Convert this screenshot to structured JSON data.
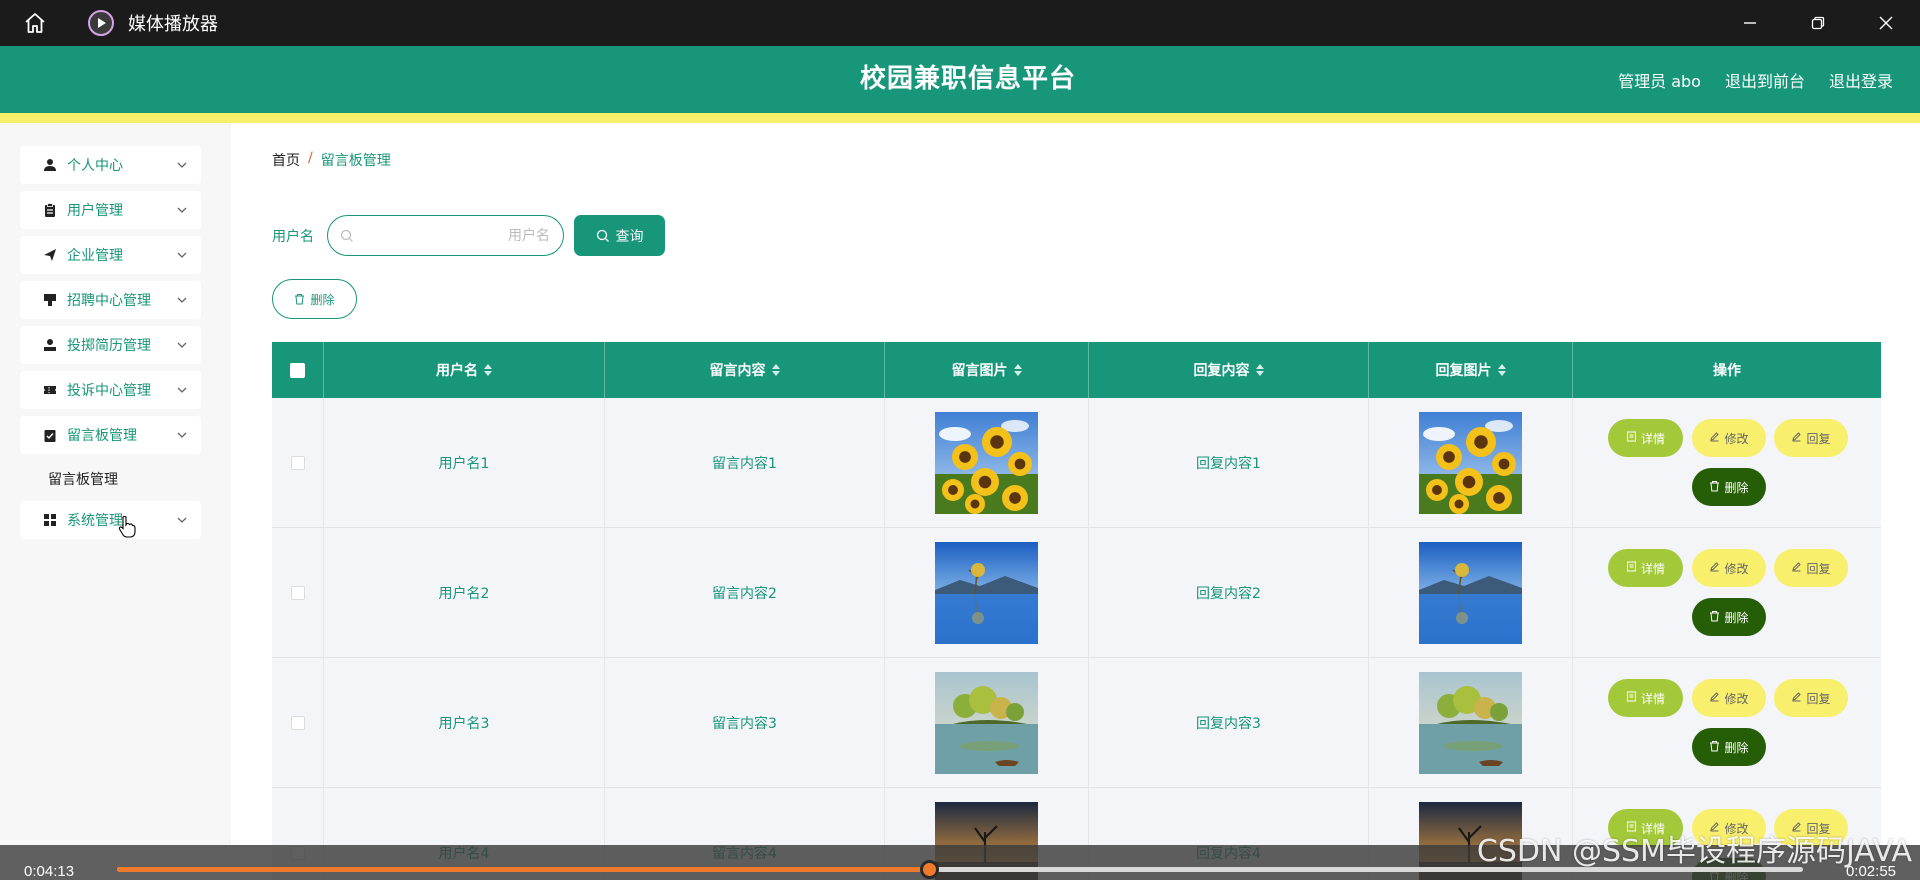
{
  "player": {
    "title": "媒体播放器",
    "time_elapsed": "0:04:13",
    "time_remaining": "0:02:55",
    "progress_fraction": 0.482
  },
  "app": {
    "title": "校园兼职信息平台",
    "admin_label": "管理员 abo",
    "goto_front": "退出到前台",
    "logout": "退出登录"
  },
  "sidebar": {
    "items": [
      {
        "label": "个人中心",
        "icon": "person-icon"
      },
      {
        "label": "用户管理",
        "icon": "clipboard-icon"
      },
      {
        "label": "企业管理",
        "icon": "send-icon"
      },
      {
        "label": "招聘中心管理",
        "icon": "banner-icon"
      },
      {
        "label": "投掷简历管理",
        "icon": "user-badge-icon"
      },
      {
        "label": "投诉中心管理",
        "icon": "ticket-icon"
      },
      {
        "label": "留言板管理",
        "icon": "checklist-icon"
      },
      {
        "label": "系统管理",
        "icon": "grid-icon"
      }
    ],
    "sub_item": "留言板管理"
  },
  "breadcrumb": {
    "home": "首页",
    "separator": "/",
    "current": "留言板管理"
  },
  "search": {
    "label": "用户名",
    "placeholder": "用户名",
    "query_button": "查询",
    "delete_button": "删除"
  },
  "table": {
    "headers": [
      "用户名",
      "留言内容",
      "留言图片",
      "回复内容",
      "回复图片",
      "操作"
    ],
    "rows": [
      {
        "username": "用户名1",
        "content": "留言内容1",
        "reply": "回复内容1",
        "image": "sunflower-image"
      },
      {
        "username": "用户名2",
        "content": "留言内容2",
        "reply": "回复内容2",
        "image": "lake-tree-image"
      },
      {
        "username": "用户名3",
        "content": "留言内容3",
        "reply": "回复内容3",
        "image": "island-image"
      },
      {
        "username": "用户名4",
        "content": "留言内容4",
        "reply": "回复内容4",
        "image": "dusk-tree-image"
      }
    ],
    "actions": {
      "detail": "详情",
      "edit": "修改",
      "reply": "回复",
      "delete": "删除"
    }
  },
  "watermark": "CSDN @SSM毕设程序源码JAVA",
  "colors": {
    "primary": "#17967a",
    "accent_yellow": "#f8ef6c",
    "detail_green": "#a3c93a",
    "delete_dark": "#265d07",
    "progress_orange": "#f07a2a"
  }
}
